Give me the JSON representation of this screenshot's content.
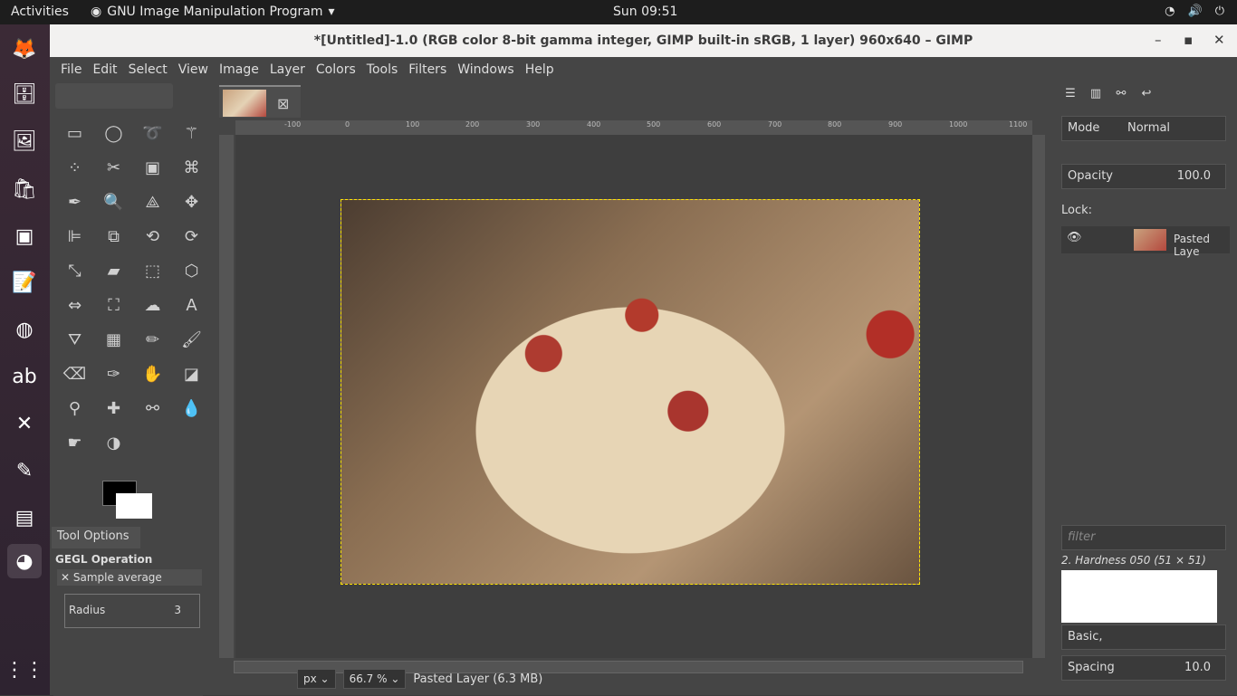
{
  "topbar": {
    "activities": "Activities",
    "app": "GNU Image Manipulation Program",
    "clock": "Sun 09:51"
  },
  "window": {
    "title": "*[Untitled]-1.0 (RGB color 8-bit gamma integer, GIMP built-in sRGB, 1 layer) 960x640 – GIMP"
  },
  "menu": [
    "File",
    "Edit",
    "Select",
    "View",
    "Image",
    "Layer",
    "Colors",
    "Tools",
    "Filters",
    "Windows",
    "Help"
  ],
  "tool_options": {
    "tab": "Tool Options",
    "heading": "GEGL Operation",
    "sample_average": "Sample average",
    "radius_label": "Radius",
    "radius_value": "3"
  },
  "ruler": {
    "h_ticks": [
      "-100",
      "0",
      "100",
      "200",
      "300",
      "400",
      "500",
      "600",
      "700",
      "800",
      "900",
      "1000",
      "1100"
    ]
  },
  "status": {
    "unit": "px",
    "zoom": "66.7 %",
    "info": "Pasted Layer (6.3 MB)"
  },
  "layers": {
    "mode_label": "Mode",
    "mode_value": "Normal",
    "opacity_label": "Opacity",
    "opacity_value": "100.0",
    "lock_label": "Lock:",
    "layer_name": "Pasted Laye"
  },
  "brushes": {
    "filter_placeholder": "filter",
    "brush_name": "2. Hardness 050 (51 × 51)",
    "preset": "Basic,",
    "spacing_label": "Spacing",
    "spacing_value": "10.0"
  }
}
